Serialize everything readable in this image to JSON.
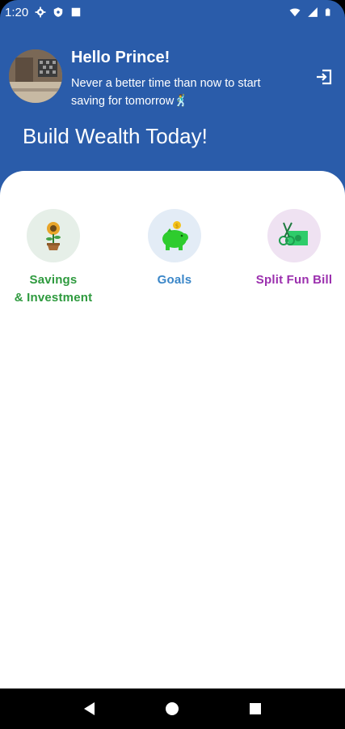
{
  "status_bar": {
    "time": "1:20",
    "icons_left": [
      "gear-icon",
      "shield-icon",
      "square-icon"
    ],
    "icons_right": [
      "wifi-icon",
      "signal-icon",
      "battery-icon"
    ]
  },
  "header": {
    "greeting": "Hello Prince!",
    "tagline": "Never a better time than now to start saving for tomorrow🕺",
    "headline": "Build Wealth Today!",
    "logout_icon": "logout-icon"
  },
  "features": [
    {
      "label_line1": "Savings",
      "label_line2": "& Investment",
      "color": "#2e9a3e",
      "bg": "#e6efe8",
      "icon": "sunflower-pot-icon"
    },
    {
      "label_line1": "Goals",
      "label_line2": "",
      "color": "#3a86c8",
      "bg": "#e3ecf6",
      "icon": "piggy-bank-icon"
    },
    {
      "label_line1": "Split Fun Bill",
      "label_line2": "",
      "color": "#9b2fae",
      "bg": "#efe2f2",
      "icon": "scissors-cash-icon"
    }
  ],
  "colors": {
    "header_bg": "#2a5caa",
    "card_bg": "#ffffff"
  },
  "nav": {
    "icons": [
      "back-icon",
      "home-icon",
      "recents-icon"
    ]
  }
}
